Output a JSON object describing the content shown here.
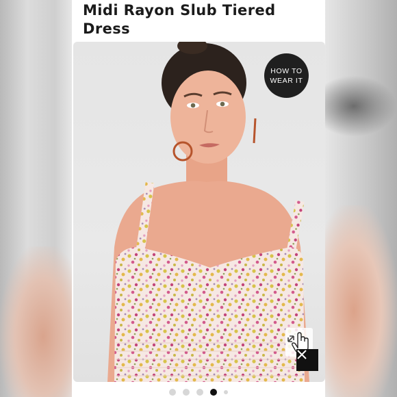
{
  "product": {
    "title_line1": "Midi Rayon Slub Tiered",
    "title_line2": "Dress"
  },
  "badge": {
    "line1": "HOW TO",
    "line2": "WEAR IT"
  },
  "gallery": {
    "dots": [
      {
        "active": false
      },
      {
        "active": false
      },
      {
        "active": false
      },
      {
        "active": true
      },
      {
        "active": false,
        "small": true
      }
    ]
  },
  "icons": {
    "zoom": "expand-hand-cursor-icon",
    "close": "close-icon"
  },
  "colors": {
    "text": "#1b1b1b",
    "badge_bg": "#1f1f1f",
    "active_dot": "#111111",
    "inactive_dot": "#d7d7d7"
  }
}
